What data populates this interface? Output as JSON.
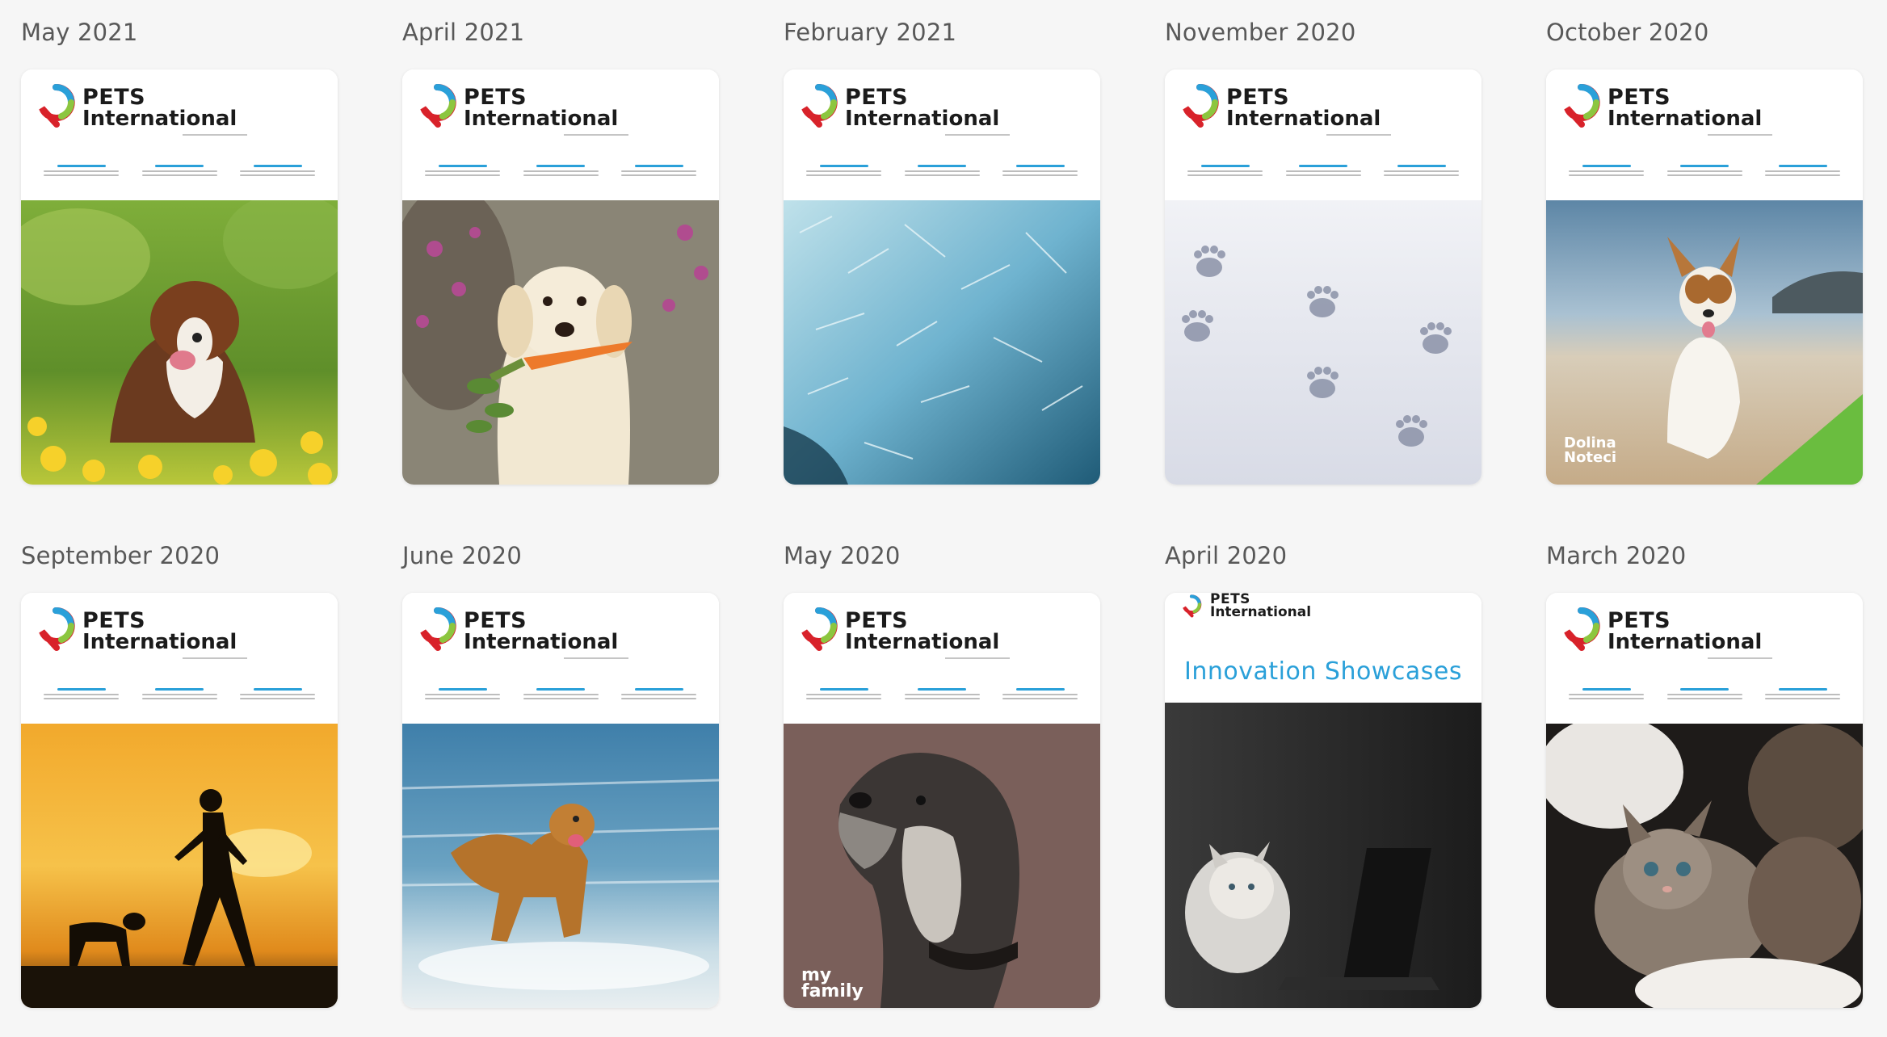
{
  "issues": [
    {
      "title": "May 2021",
      "brand_top": "PETS",
      "brand_bottom": "International",
      "photo": "dog-in-flowers"
    },
    {
      "title": "April 2021",
      "brand_top": "PETS",
      "brand_bottom": "International",
      "photo": "dog-with-carrot"
    },
    {
      "title": "February 2021",
      "brand_top": "PETS",
      "brand_bottom": "International",
      "photo": "frozen-ice"
    },
    {
      "title": "November 2020",
      "brand_top": "PETS",
      "brand_bottom": "International",
      "photo": "paw-prints-snow"
    },
    {
      "title": "October 2020",
      "brand_top": "PETS",
      "brand_bottom": "International",
      "photo": "dog-on-beach",
      "overlay": "Dolina Noteci"
    },
    {
      "title": "September 2020",
      "brand_top": "PETS",
      "brand_bottom": "International",
      "photo": "sunset-run"
    },
    {
      "title": "June 2020",
      "brand_top": "PETS",
      "brand_bottom": "International",
      "photo": "dog-in-sea"
    },
    {
      "title": "May 2020",
      "brand_top": "PETS",
      "brand_bottom": "International",
      "photo": "schnauzer",
      "overlay": "my family"
    },
    {
      "title": "April 2020",
      "brand_top": "PETS",
      "brand_bottom": "International",
      "photo": "cat-laptop",
      "headline": "Innovation Showcases"
    },
    {
      "title": "March 2020",
      "brand_top": "PETS",
      "brand_bottom": "International",
      "photo": "kittens"
    }
  ],
  "colors": {
    "accent": "#2aa0d9",
    "logo_red": "#d8222a",
    "logo_green": "#8cc63f",
    "background": "#f6f6f6"
  }
}
